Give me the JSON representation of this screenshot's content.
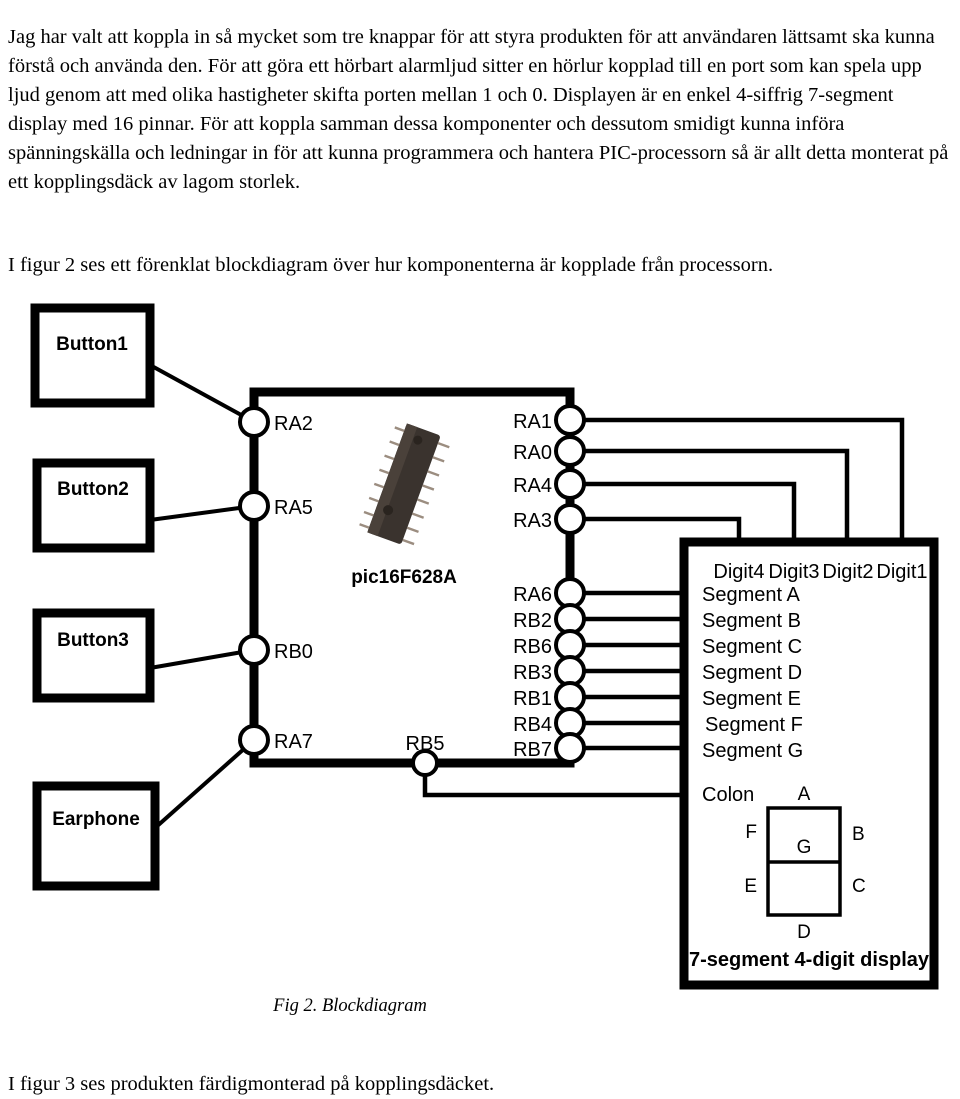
{
  "document": {
    "paragraph1": "Jag har valt att koppla in så mycket som tre knappar för att styra produkten för att användaren lättsamt ska kunna förstå och använda den. För att göra ett hörbart alarmljud sitter en hörlur kopplad till en port som kan spela upp ljud genom att med olika hastigheter skifta porten mellan 1 och 0. Displayen är en enkel 4-siffrig 7-segment display med 16 pinnar. För att koppla samman dessa komponenter och dessutom smidigt kunna införa spänningskälla och ledningar in för att kunna programmera och hantera PIC-processorn så är allt detta monterat på ett kopplingsdäck av lagom storlek.",
    "paragraph2": "I figur 2 ses ett förenklat blockdiagram över hur komponenterna är kopplade från processorn.",
    "paragraph3": "I figur 3 ses produkten färdigmonterad på kopplingsdäcket.",
    "figure_caption": "Fig 2. Blockdiagram"
  },
  "diagram": {
    "left_blocks": [
      {
        "label": "Button1",
        "pin": "RA2"
      },
      {
        "label": "Button2",
        "pin": "RA5"
      },
      {
        "label": "Button3",
        "pin": "RB0"
      },
      {
        "label": "Earphone",
        "pin": "RA7"
      }
    ],
    "chip": {
      "name": "pic16F628A",
      "left_pins": [
        "RA2",
        "RA5",
        "RB0",
        "RA7"
      ],
      "bottom_pins": [
        "RB5"
      ],
      "right_pins_upper": [
        "RA1",
        "RA0",
        "RA4",
        "RA3"
      ],
      "right_pins_lower": [
        "RA6",
        "RB2",
        "RB6",
        "RB3",
        "RB1",
        "RB4",
        "RB7"
      ]
    },
    "display": {
      "title": "7-segment 4-digit display",
      "digits": [
        "Digit4",
        "Digit3",
        "Digit2",
        "Digit1"
      ],
      "segments": [
        "Segment A",
        "Segment B",
        "Segment C",
        "Segment D",
        "Segment E",
        "Segment F",
        "Segment G"
      ],
      "colon": "Colon",
      "seven_segment_letters": {
        "top": "A",
        "top_left": "F",
        "top_right": "B",
        "middle": "G",
        "bottom_left": "E",
        "bottom_right": "C",
        "bottom": "D"
      }
    },
    "connections": [
      {
        "from": "Button1",
        "to": "RA2"
      },
      {
        "from": "Button2",
        "to": "RA5"
      },
      {
        "from": "Button3",
        "to": "RB0"
      },
      {
        "from": "Earphone",
        "to": "RA7"
      },
      {
        "from": "RA1",
        "to": "Digit1"
      },
      {
        "from": "RA0",
        "to": "Digit2"
      },
      {
        "from": "RA4",
        "to": "Digit3"
      },
      {
        "from": "RA3",
        "to": "Digit4"
      },
      {
        "from": "RA6",
        "to": "Segment A"
      },
      {
        "from": "RB2",
        "to": "Segment B"
      },
      {
        "from": "RB6",
        "to": "Segment C"
      },
      {
        "from": "RB3",
        "to": "Segment D"
      },
      {
        "from": "RB1",
        "to": "Segment E"
      },
      {
        "from": "RB4",
        "to": "Segment F"
      },
      {
        "from": "RB7",
        "to": "Segment G"
      },
      {
        "from": "RB5",
        "to": "Colon"
      }
    ]
  },
  "colors": {
    "ink": "#000000",
    "page": "#ffffff",
    "chip_body": "#3a332e"
  }
}
